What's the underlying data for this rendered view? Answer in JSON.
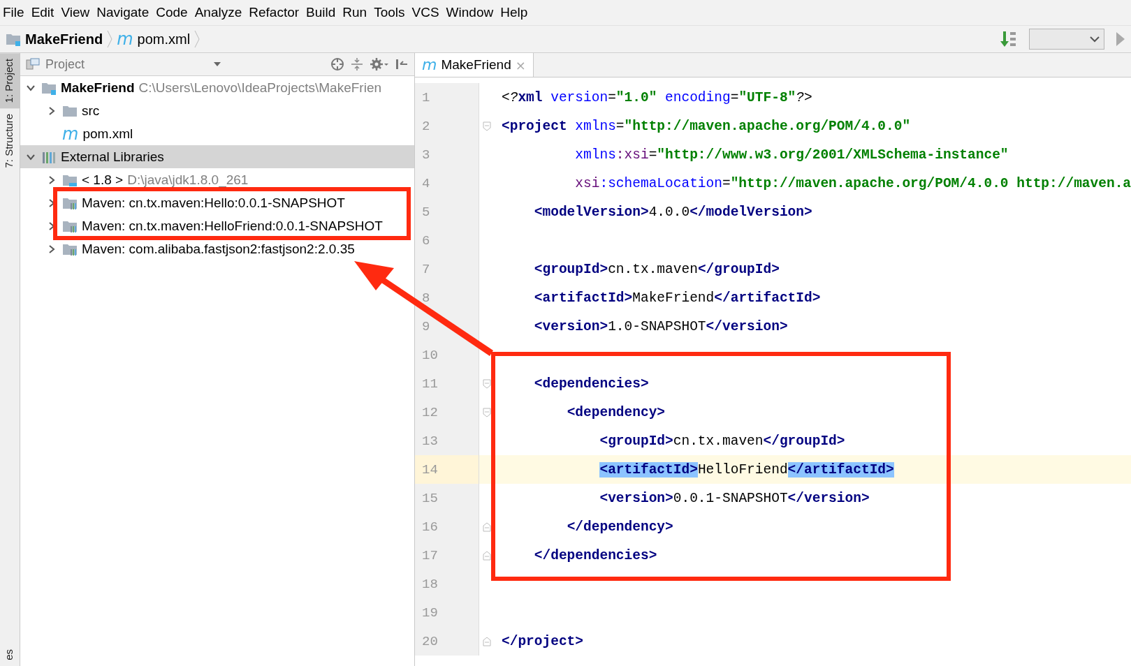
{
  "menu": [
    "File",
    "Edit",
    "View",
    "Navigate",
    "Code",
    "Analyze",
    "Refactor",
    "Build",
    "Run",
    "Tools",
    "VCS",
    "Window",
    "Help"
  ],
  "breadcrumb": {
    "project": "MakeFriend",
    "file_glyph": "m",
    "file": "pom.xml"
  },
  "tool_strip": [
    {
      "label": "1: Project",
      "selected": true
    },
    {
      "label": "7: Structure",
      "selected": false
    },
    {
      "label": "es",
      "selected": false
    }
  ],
  "project_panel": {
    "title": "Project",
    "tree": [
      {
        "label": "MakeFriend",
        "hint": "C:\\Users\\Lenovo\\IdeaProjects\\MakeFrien",
        "kind": "module",
        "expandable": true,
        "expanded": true,
        "selected": false,
        "children": [
          {
            "label": "src",
            "kind": "folder",
            "expandable": true,
            "expanded": false,
            "selected": false
          },
          {
            "label": "pom.xml",
            "kind": "maven",
            "glyph": "m",
            "expandable": false,
            "selected": false
          }
        ]
      },
      {
        "label": "External Libraries",
        "kind": "libraries",
        "expandable": true,
        "expanded": true,
        "selected": true,
        "children": [
          {
            "label": "< 1.8 >",
            "hint": "D:\\java\\jdk1.8.0_261",
            "kind": "jdk",
            "expandable": true,
            "expanded": false,
            "selected": false
          },
          {
            "label": "Maven: cn.tx.maven:Hello:0.0.1-SNAPSHOT",
            "kind": "library",
            "expandable": true,
            "expanded": false,
            "selected": false
          },
          {
            "label": "Maven: cn.tx.maven:HelloFriend:0.0.1-SNAPSHOT",
            "kind": "library",
            "expandable": true,
            "expanded": false,
            "selected": false
          },
          {
            "label": "Maven: com.alibaba.fastjson2:fastjson2:2.0.35",
            "kind": "library",
            "expandable": true,
            "expanded": false,
            "selected": false
          }
        ]
      }
    ]
  },
  "editor": {
    "tabs": [
      {
        "glyph": "m",
        "label": "MakeFriend",
        "close": "×",
        "selected": true
      }
    ],
    "lines": [
      {
        "n": "1",
        "current": false,
        "fold_open": false,
        "fold_close": false,
        "tokens": [
          {
            "kind": "punct",
            "t": "<?"
          },
          {
            "kind": "tag",
            "t": "xml"
          },
          {
            "kind": "attr",
            "t": " version"
          },
          {
            "kind": "text",
            "t": "="
          },
          {
            "kind": "value",
            "t": "\"1.0\""
          },
          {
            "kind": "attr",
            "t": " encoding"
          },
          {
            "kind": "text",
            "t": "="
          },
          {
            "kind": "value",
            "t": "\"UTF-8\""
          },
          {
            "kind": "punct",
            "t": "?>"
          }
        ]
      },
      {
        "n": "2",
        "current": false,
        "fold_open": true,
        "fold_close": false,
        "tokens": [
          {
            "kind": "tag",
            "t": "<project"
          },
          {
            "kind": "attr",
            "t": " xmlns"
          },
          {
            "kind": "text",
            "t": "="
          },
          {
            "kind": "value",
            "t": "\"http://maven.apache.org/POM/4.0.0\""
          }
        ]
      },
      {
        "n": "3",
        "current": false,
        "fold_open": false,
        "fold_close": false,
        "tokens": [
          {
            "kind": "attr",
            "t": "         xmlns"
          },
          {
            "kind": "ns",
            "t": ":xsi"
          },
          {
            "kind": "text",
            "t": "="
          },
          {
            "kind": "value",
            "t": "\"http://www.w3.org/2001/XMLSchema-instance\""
          }
        ]
      },
      {
        "n": "4",
        "current": false,
        "fold_open": false,
        "fold_close": false,
        "tokens": [
          {
            "kind": "ns",
            "t": "         xsi"
          },
          {
            "kind": "attr",
            "t": ":schemaLocation"
          },
          {
            "kind": "text",
            "t": "="
          },
          {
            "kind": "value",
            "t": "\"http://maven.apache.org/POM/4.0.0 http://maven.a"
          }
        ]
      },
      {
        "n": "5",
        "current": false,
        "fold_open": false,
        "fold_close": false,
        "tokens": [
          {
            "kind": "tag",
            "t": "    <modelVersion>"
          },
          {
            "kind": "text",
            "t": "4.0.0"
          },
          {
            "kind": "tag",
            "t": "</modelVersion>"
          }
        ]
      },
      {
        "n": "6",
        "current": false,
        "fold_open": false,
        "fold_close": false
      },
      {
        "n": "7",
        "current": false,
        "fold_open": false,
        "fold_close": false,
        "tokens": [
          {
            "kind": "tag",
            "t": "    <groupId>"
          },
          {
            "kind": "text",
            "t": "cn.tx.maven"
          },
          {
            "kind": "tag",
            "t": "</groupId>"
          }
        ]
      },
      {
        "n": "8",
        "current": false,
        "fold_open": false,
        "fold_close": false,
        "tokens": [
          {
            "kind": "tag",
            "t": "    <artifactId>"
          },
          {
            "kind": "text",
            "t": "MakeFriend"
          },
          {
            "kind": "tag",
            "t": "</artifactId>"
          }
        ]
      },
      {
        "n": "9",
        "current": false,
        "fold_open": false,
        "fold_close": false,
        "tokens": [
          {
            "kind": "tag",
            "t": "    <version>"
          },
          {
            "kind": "text",
            "t": "1.0-SNAPSHOT"
          },
          {
            "kind": "tag",
            "t": "</version>"
          }
        ]
      },
      {
        "n": "10",
        "current": false,
        "fold_open": false,
        "fold_close": false
      },
      {
        "n": "11",
        "current": false,
        "fold_open": true,
        "fold_close": false,
        "tokens": [
          {
            "kind": "tag",
            "t": "    <dependencies>"
          }
        ]
      },
      {
        "n": "12",
        "current": false,
        "fold_open": true,
        "fold_close": false,
        "tokens": [
          {
            "kind": "tag",
            "t": "        <dependency>"
          }
        ]
      },
      {
        "n": "13",
        "current": false,
        "fold_open": false,
        "fold_close": false,
        "tokens": [
          {
            "kind": "tag",
            "t": "            <groupId>"
          },
          {
            "kind": "text",
            "t": "cn.tx.maven"
          },
          {
            "kind": "tag",
            "t": "</groupId>"
          }
        ]
      },
      {
        "n": "14",
        "current": true,
        "fold_open": false,
        "fold_close": false,
        "tokens": [
          {
            "kind": "tag",
            "t": "            <artifactId>",
            "highlighted": true
          },
          {
            "kind": "text",
            "t": "HelloFriend",
            "highlighted": false
          },
          {
            "kind": "tag",
            "t": "</artifactId>",
            "highlighted": true
          }
        ]
      },
      {
        "n": "15",
        "current": false,
        "fold_open": false,
        "fold_close": false,
        "tokens": [
          {
            "kind": "tag",
            "t": "            <version>"
          },
          {
            "kind": "text",
            "t": "0.0.1-SNAPSHOT"
          },
          {
            "kind": "tag",
            "t": "</version>"
          }
        ]
      },
      {
        "n": "16",
        "current": false,
        "fold_open": false,
        "fold_close": true,
        "tokens": [
          {
            "kind": "tag",
            "t": "        </dependency>"
          }
        ]
      },
      {
        "n": "17",
        "current": false,
        "fold_open": false,
        "fold_close": true,
        "tokens": [
          {
            "kind": "tag",
            "t": "    </dependencies>"
          }
        ]
      },
      {
        "n": "18",
        "current": false,
        "fold_open": false,
        "fold_close": false
      },
      {
        "n": "19",
        "current": false,
        "fold_open": false,
        "fold_close": false
      },
      {
        "n": "20",
        "current": false,
        "fold_open": false,
        "fold_close": true,
        "tokens": [
          {
            "kind": "tag",
            "t": "</project>"
          }
        ]
      }
    ]
  }
}
